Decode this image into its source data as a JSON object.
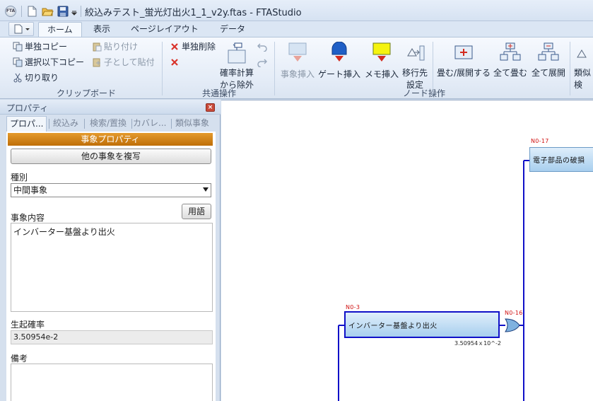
{
  "window": {
    "title": "絞込みテスト_蛍光灯出火1_1_v2y.ftas - FTAStudio",
    "app_logo": "FTA"
  },
  "ribbon_tabs": [
    {
      "label": "ホーム",
      "active": true
    },
    {
      "label": "表示",
      "active": false
    },
    {
      "label": "ページレイアウト",
      "active": false
    },
    {
      "label": "データ",
      "active": false
    }
  ],
  "ribbon": {
    "clipboard": {
      "single_copy": "単独コピー",
      "copy_below": "選択以下コピー",
      "cut": "切り取り",
      "paste": "貼り付け",
      "paste_as_child": "子として貼付",
      "group_label": "クリップボード"
    },
    "common": {
      "single_delete": "単独削除",
      "calc_exclude_line1": "確率計算",
      "calc_exclude_line2": "から除外",
      "group_label": "共通操作"
    },
    "node": {
      "insert_event": "事象挿入",
      "insert_gate": "ゲート挿入",
      "insert_memo": "メモ挿入",
      "set_target_line1": "移行先",
      "set_target_line2": "設定",
      "group_label": "ノード操作"
    },
    "fold": {
      "fold_expand": "畳む/展開する",
      "fold_all": "全て畳む",
      "expand_all": "全て展開"
    },
    "similar": {
      "line1": "類似",
      "line2": "検"
    }
  },
  "properties_pane": {
    "title": "プロパティ",
    "tabs": [
      "プロパ...",
      "絞込み",
      "検索/置換",
      "カバレ...",
      "類似事象"
    ],
    "section_title": "事象プロパティ",
    "copy_event_button": "他の事象を複写",
    "type_label": "種別",
    "type_value": "中間事象",
    "content_label": "事象内容",
    "glossary_button": "用語",
    "content_value": "インバーター基盤より出火",
    "probability_label": "生起確率",
    "probability_value": "3.50954e-2",
    "remarks_label": "備考",
    "remarks_value": ""
  },
  "canvas": {
    "nodes": [
      {
        "id": "N0-17",
        "label": "電子部品の破損",
        "probability": ""
      },
      {
        "id": "N0-3",
        "label": "インバーター基盤より出火",
        "probability": "3.50954ｘ10^-2"
      },
      {
        "id": "N0-16",
        "gate": "or-gate"
      }
    ],
    "colors": {
      "node_id": "#d01010",
      "connector": "#1010c8",
      "event_fill": "#a8cfee",
      "gate_fill": "#7fb2e0"
    }
  }
}
